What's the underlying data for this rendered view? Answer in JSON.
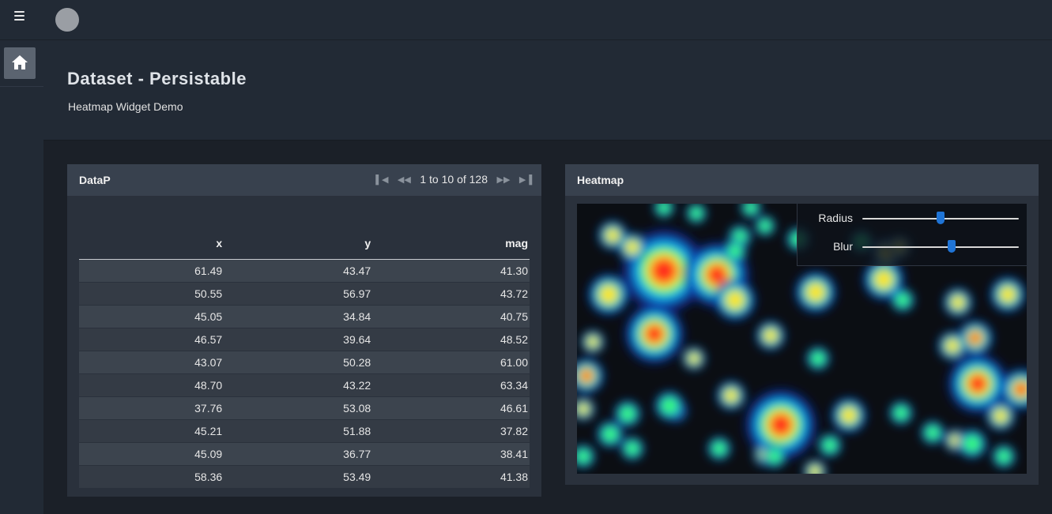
{
  "header": {
    "menu_icon": "hamburger-icon",
    "avatar_icon": "user-avatar"
  },
  "sidebar": {
    "items": [
      {
        "icon": "home-icon",
        "active": true
      }
    ]
  },
  "page": {
    "title": "Dataset - Persistable",
    "subtitle": "Heatmap Widget Demo"
  },
  "data_panel": {
    "title": "DataP",
    "pager": {
      "text": "1 to 10 of 128",
      "first_icon": "first-page-icon",
      "prev_icon": "previous-page-icon",
      "next_icon": "next-page-icon",
      "last_icon": "last-page-icon"
    },
    "columns": [
      "x",
      "y",
      "mag"
    ],
    "rows": [
      [
        "61.49",
        "43.47",
        "41.30"
      ],
      [
        "50.55",
        "56.97",
        "43.72"
      ],
      [
        "45.05",
        "34.84",
        "40.75"
      ],
      [
        "46.57",
        "39.64",
        "48.52"
      ],
      [
        "43.07",
        "50.28",
        "61.00"
      ],
      [
        "48.70",
        "43.22",
        "63.34"
      ],
      [
        "37.76",
        "53.08",
        "46.61"
      ],
      [
        "45.21",
        "51.88",
        "37.82"
      ],
      [
        "45.09",
        "36.77",
        "38.41"
      ],
      [
        "58.36",
        "53.49",
        "41.38"
      ]
    ]
  },
  "heatmap_panel": {
    "title": "Heatmap",
    "controls": {
      "radius": {
        "label": "Radius",
        "level": 0.5
      },
      "blur": {
        "label": "Blur",
        "level": 0.57
      }
    }
  },
  "colors": {
    "accent": "#1f74d6",
    "background": "#1b2028",
    "panel": "#2a313c"
  }
}
